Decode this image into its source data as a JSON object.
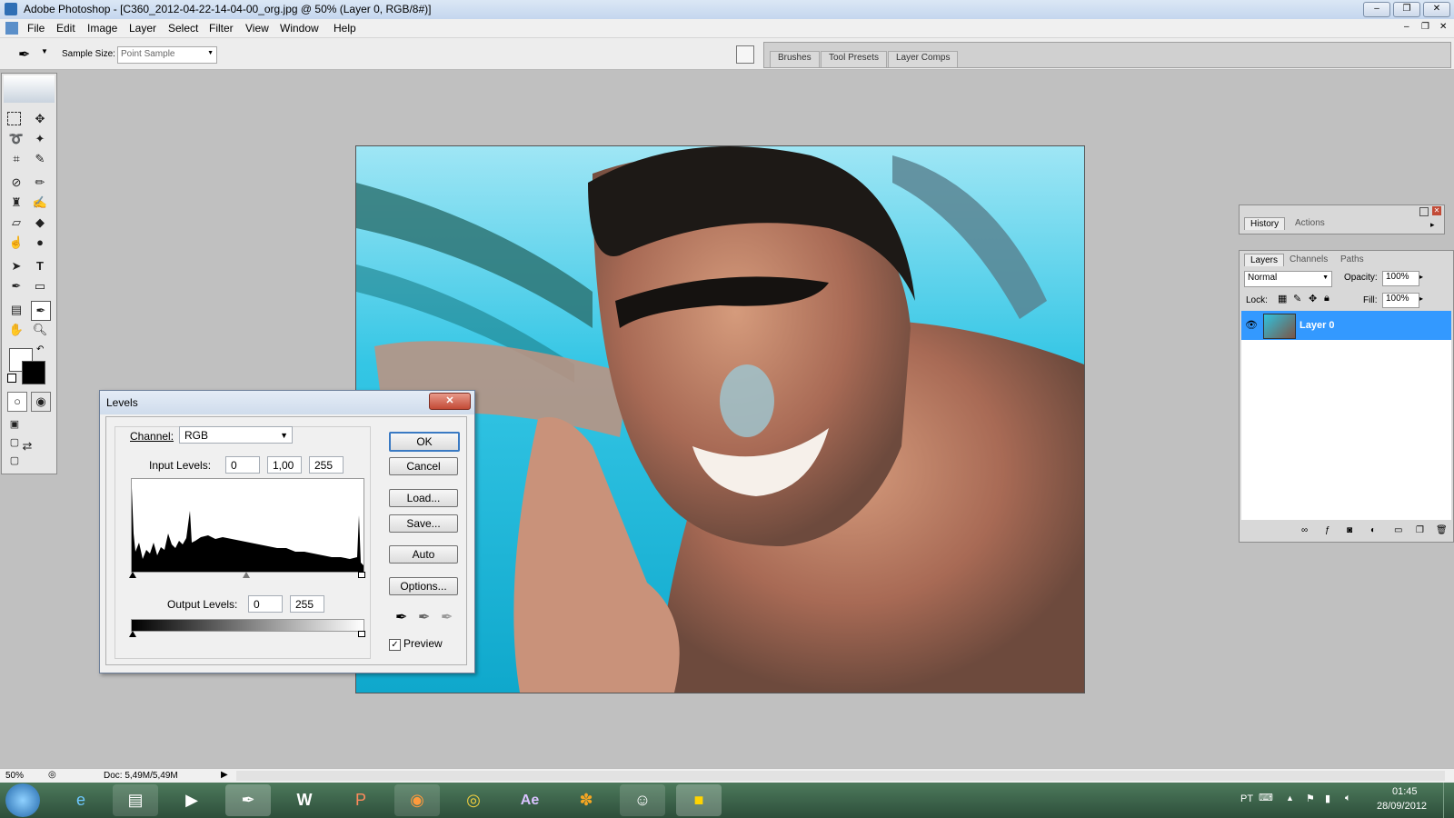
{
  "window": {
    "title": "Adobe Photoshop - [C360_2012-04-22-14-04-00_org.jpg @ 50% (Layer 0, RGB/8#)]",
    "buttons": [
      "–",
      "❐",
      "✕"
    ],
    "doc_buttons": [
      "–",
      "❐",
      "✕"
    ]
  },
  "menu": [
    "File",
    "Edit",
    "Image",
    "Layer",
    "Select",
    "Filter",
    "View",
    "Window",
    "Help"
  ],
  "options_bar": {
    "sample_size_label": "Sample Size:",
    "sample_size_value": "Point Sample",
    "dock_tabs": [
      "Brushes",
      "Tool Presets",
      "Layer Comps"
    ]
  },
  "levels_dialog": {
    "title": "Levels",
    "close": "✕",
    "channel_label": "Channel:",
    "channel_value": "RGB",
    "input_label": "Input Levels:",
    "input_values": [
      "0",
      "1,00",
      "255"
    ],
    "output_label": "Output Levels:",
    "output_values": [
      "0",
      "255"
    ],
    "buttons": {
      "ok": "OK",
      "cancel": "Cancel",
      "load": "Load...",
      "save": "Save...",
      "auto": "Auto",
      "options": "Options..."
    },
    "preview_label": "Preview",
    "preview_checked": true
  },
  "history_panel": {
    "tabs": [
      "History",
      "Actions"
    ]
  },
  "layers_panel": {
    "tabs": [
      "Layers",
      "Channels",
      "Paths"
    ],
    "blend_mode": "Normal",
    "opacity_label": "Opacity:",
    "opacity_value": "100%",
    "lock_label": "Lock:",
    "fill_label": "Fill:",
    "fill_value": "100%",
    "layers": [
      {
        "name": "Layer 0",
        "visible": true,
        "selected": true
      }
    ]
  },
  "status_bar": {
    "zoom": "50%",
    "doc": "Doc: 5,49M/5,49M"
  },
  "taskbar": {
    "items": [
      "ie-icon",
      "explorer-icon",
      "media-icon",
      "photoshop-icon",
      "word-icon",
      "powerpoint-icon",
      "firefox-icon",
      "chrome-icon",
      "aftereffects-icon",
      "windowsmedia-icon",
      "messenger-icon",
      "paint-icon"
    ],
    "ae_label": "Ae",
    "lang": "PT",
    "time": "01:45",
    "date": "28/09/2012"
  },
  "colors": {
    "selection": "#3399ff",
    "accent_water": "#2fc3e0"
  }
}
